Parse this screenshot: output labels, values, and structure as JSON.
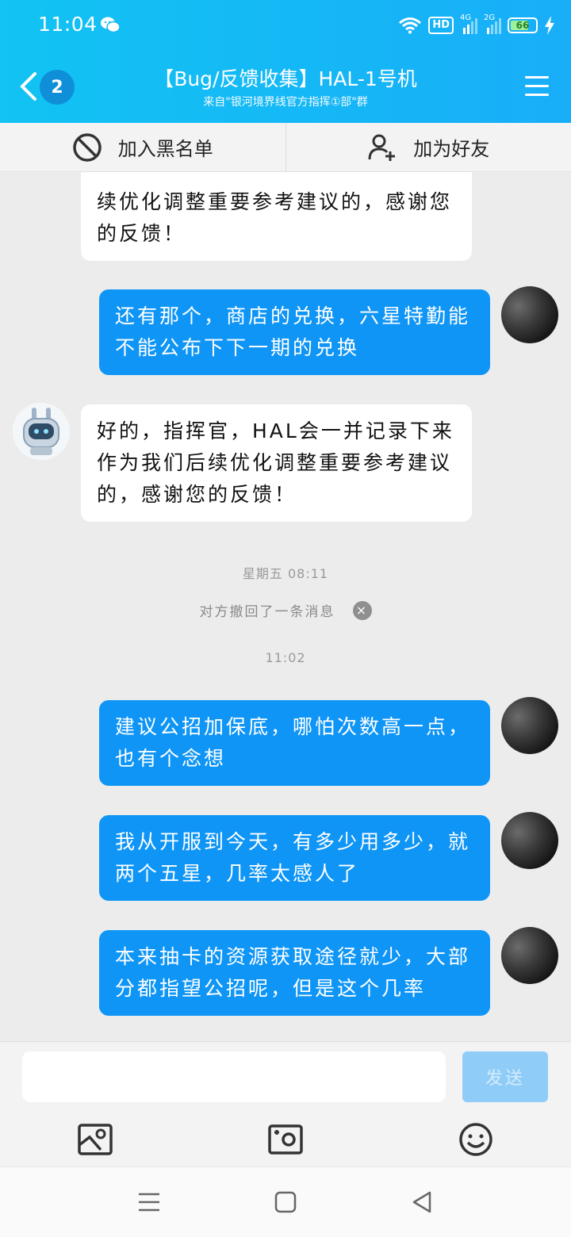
{
  "status_bar": {
    "time": "11:04",
    "hd": "HD",
    "sim1": "4G",
    "sim2": "2G",
    "battery": "66"
  },
  "header": {
    "unread_count": "2",
    "title": "【Bug/反馈收集】HAL-1号机",
    "subtitle": "来自\"银河境界线官方指挥①部\"群"
  },
  "actions": {
    "blacklist": "加入黑名单",
    "add_friend": "加为好友"
  },
  "messages": [
    {
      "side": "left",
      "text": "续优化调整重要参考建议的，感谢您的反馈！"
    },
    {
      "side": "right",
      "text": "还有那个，商店的兑换，六星特勤能不能公布下下一期的兑换"
    },
    {
      "side": "left",
      "text": "好的，指挥官，HAL会一并记录下来作为我们后续优化调整重要参考建议的，感谢您的反馈！"
    },
    {
      "side": "right",
      "text": "建议公招加保底，哪怕次数高一点，也有个念想"
    },
    {
      "side": "right",
      "text": "我从开服到今天，有多少用多少，就两个五星，几率太感人了"
    },
    {
      "side": "right",
      "text": "本来抽卡的资源获取途径就少，大部分都指望公招呢，但是这个几率"
    }
  ],
  "system": {
    "timestamp1": "星期五 08:11",
    "recall_notice": "对方撤回了一条消息",
    "timestamp2": "11:02"
  },
  "composer": {
    "placeholder": "",
    "send_label": "发送"
  },
  "colors": {
    "header": "#12c3f3",
    "bubble_right": "#0f95f6",
    "bubble_left": "#ffffff",
    "background": "#ececec"
  },
  "icons": {
    "back": "chevron-left-icon",
    "menu": "hamburger-icon",
    "block": "block-icon",
    "add_friend": "add-user-icon",
    "image": "image-icon",
    "camera": "camera-icon",
    "emoji": "emoji-icon"
  }
}
